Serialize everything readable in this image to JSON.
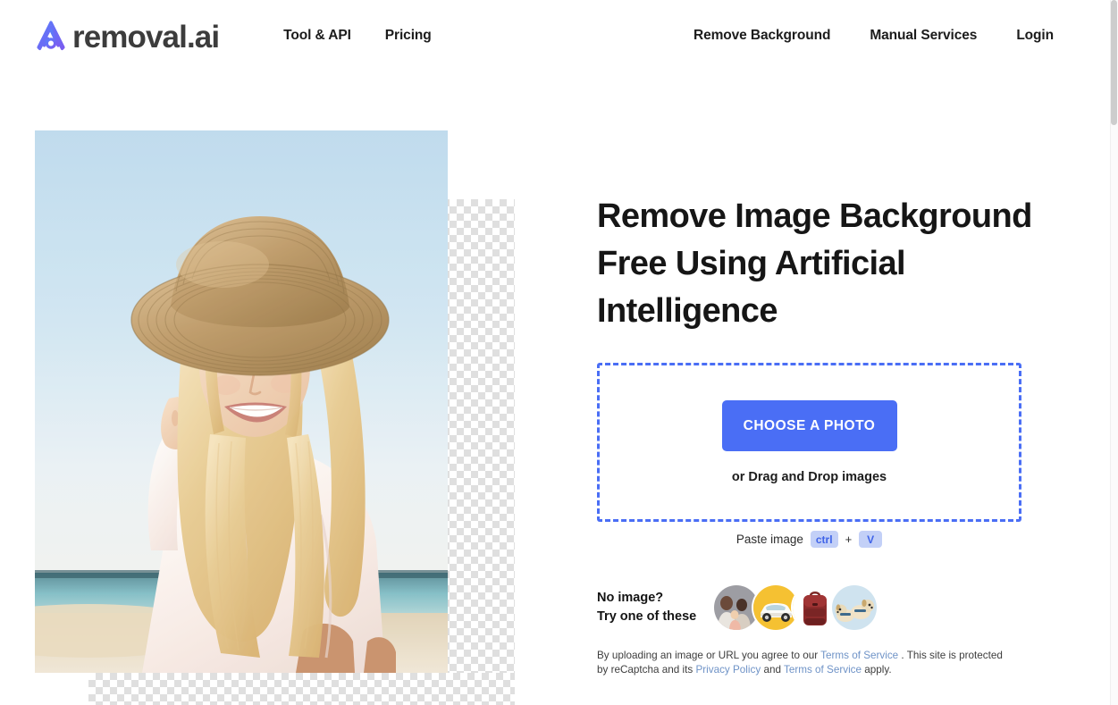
{
  "brand": {
    "name": "removal.ai",
    "logo_icon": "removal-ai-logo-icon",
    "logo_color_start": "#5b7cfa",
    "logo_color_end": "#7a5cf0"
  },
  "nav": {
    "left_items": [
      {
        "label": "Tool & API"
      },
      {
        "label": "Pricing"
      }
    ],
    "right_items": [
      {
        "label": "Remove Background"
      },
      {
        "label": "Manual Services"
      },
      {
        "label": "Login"
      }
    ]
  },
  "hero": {
    "image_alt": "Woman in straw hat at the beach with background partially removed",
    "transparency_checker": "checkerboard-pattern"
  },
  "main": {
    "headline": "Remove Image Background Free Using Artificial Intelligence",
    "dropzone": {
      "button_label": "CHOOSE A PHOTO",
      "drag_text": "or Drag and Drop images",
      "border_color": "#4a6ef5",
      "button_color": "#4a6ef5"
    },
    "paste": {
      "label": "Paste image",
      "key_modifier": "ctrl",
      "separator": "+",
      "key_letter": "V",
      "key_bg": "#c3d0f7",
      "key_fg": "#3f63e8"
    },
    "samples": {
      "line1": "No image?",
      "line2": "Try one of these",
      "thumbnails": [
        {
          "name": "sample-family-photo",
          "bg": "#9d9da3"
        },
        {
          "name": "sample-car-photo",
          "bg": "#f5c132"
        },
        {
          "name": "sample-backpack-photo",
          "bg": "#ffffff"
        },
        {
          "name": "sample-dogs-photo",
          "bg": "#cfe3ef"
        }
      ]
    },
    "legal": {
      "part1": "By uploading an image or URL you agree to our ",
      "link1": "Terms of Service",
      "part2": " . This site is protected by reCaptcha and its ",
      "link2": "Privacy Policy",
      "part3": " and ",
      "link3": "Terms of Service",
      "part4": " apply.",
      "link_color": "#6f93c7"
    }
  }
}
